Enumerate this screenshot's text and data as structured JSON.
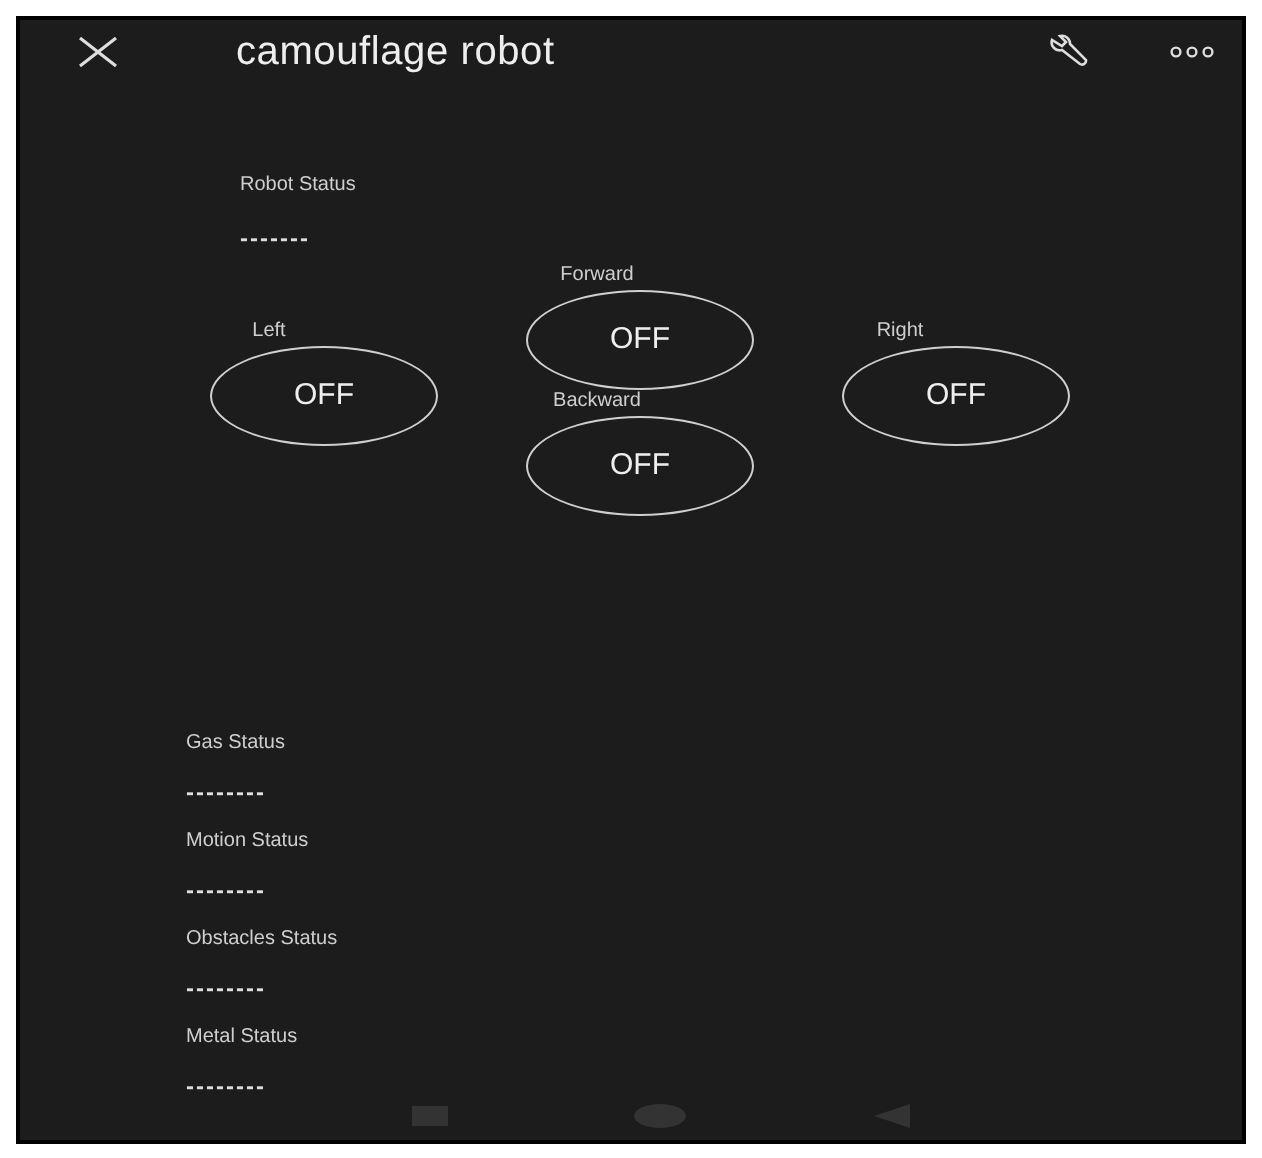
{
  "app_bar": {
    "title": "camouflage robot"
  },
  "robot_status": {
    "label": "Robot Status",
    "value": "-------"
  },
  "controls": [
    {
      "kind": "left",
      "label": "Left",
      "value": "OFF"
    },
    {
      "kind": "forward",
      "label": "Forward",
      "value": "OFF"
    },
    {
      "kind": "backward",
      "label": "Backward",
      "value": "OFF"
    },
    {
      "kind": "right",
      "label": "Right",
      "value": "OFF"
    }
  ],
  "sensors": [
    {
      "label": "Gas Status",
      "value": "--------"
    },
    {
      "label": "Motion Status",
      "value": "--------"
    },
    {
      "label": "Obstacles Status",
      "value": "--------"
    },
    {
      "label": "Metal Status",
      "value": "--------"
    }
  ]
}
